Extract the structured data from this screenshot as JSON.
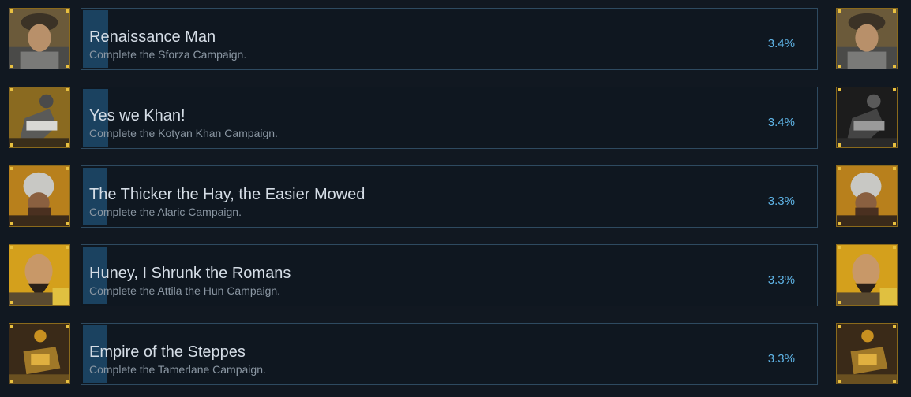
{
  "achievements": [
    {
      "title": "Renaissance Man",
      "description": "Complete the Sforza Campaign.",
      "percent": "3.4%",
      "percent_value": 3.4,
      "icon": "sforza-portrait-icon",
      "right_icon_unlocked": true
    },
    {
      "title": "Yes we Khan!",
      "description": "Complete the Kotyan Khan Campaign.",
      "percent": "3.4%",
      "percent_value": 3.4,
      "icon": "kotyan-khan-portrait-icon",
      "right_icon_unlocked": false
    },
    {
      "title": "The Thicker the Hay, the Easier Mowed",
      "description": "Complete the Alaric Campaign.",
      "percent": "3.3%",
      "percent_value": 3.3,
      "icon": "alaric-portrait-icon",
      "right_icon_unlocked": true
    },
    {
      "title": "Huney, I Shrunk the Romans",
      "description": "Complete the Attila the Hun Campaign.",
      "percent": "3.3%",
      "percent_value": 3.3,
      "icon": "attila-portrait-icon",
      "right_icon_unlocked": true
    },
    {
      "title": "Empire of the Steppes",
      "description": "Complete the Tamerlane Campaign.",
      "percent": "3.3%",
      "percent_value": 3.3,
      "icon": "tamerlane-portrait-icon",
      "right_icon_unlocked": true
    }
  ],
  "colors": {
    "background": "#111821",
    "panel_border": "#2e4a60",
    "progress_fill": "#1b4260",
    "percent_text": "#5fb4e6",
    "icon_frame": "#8a6a1c"
  }
}
